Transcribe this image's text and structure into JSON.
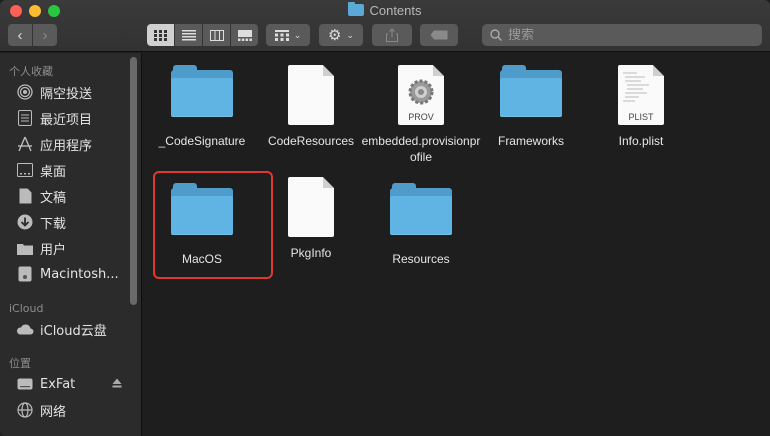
{
  "window": {
    "title": "Contents"
  },
  "toolbar": {
    "search_placeholder": "搜索",
    "view_modes": [
      "icon-view",
      "list-view",
      "column-view",
      "gallery-view"
    ]
  },
  "sidebar": {
    "favorites_header": "个人收藏",
    "favorites": [
      {
        "label": "隔空投送",
        "icon": "airdrop-icon"
      },
      {
        "label": "最近项目",
        "icon": "recents-icon"
      },
      {
        "label": "应用程序",
        "icon": "applications-icon"
      },
      {
        "label": "桌面",
        "icon": "desktop-icon"
      },
      {
        "label": "文稿",
        "icon": "documents-icon"
      },
      {
        "label": "下载",
        "icon": "downloads-icon"
      },
      {
        "label": "用户",
        "icon": "folder-icon"
      },
      {
        "label": "Macintosh...",
        "icon": "hard-drive-icon"
      }
    ],
    "icloud_header": "iCloud",
    "icloud": [
      {
        "label": "iCloud云盘",
        "icon": "cloud-icon"
      }
    ],
    "locations_header": "位置",
    "locations": [
      {
        "label": "ExFat",
        "icon": "drive-icon"
      },
      {
        "label": "网络",
        "icon": "network-icon"
      }
    ]
  },
  "files": [
    {
      "name": "_CodeSignature",
      "kind": "folder"
    },
    {
      "name": "CodeResources",
      "kind": "document"
    },
    {
      "name": "embedded.provisionprofile",
      "kind": "prov",
      "badge": "PROV"
    },
    {
      "name": "Frameworks",
      "kind": "folder"
    },
    {
      "name": "Info.plist",
      "kind": "plist",
      "badge": "PLIST"
    },
    {
      "name": "MacOS",
      "kind": "folder",
      "highlighted": true
    },
    {
      "name": "PkgInfo",
      "kind": "document"
    },
    {
      "name": "Resources",
      "kind": "folder"
    }
  ],
  "colors": {
    "folder": "#5fb4e3",
    "highlight": "#e0382f"
  }
}
